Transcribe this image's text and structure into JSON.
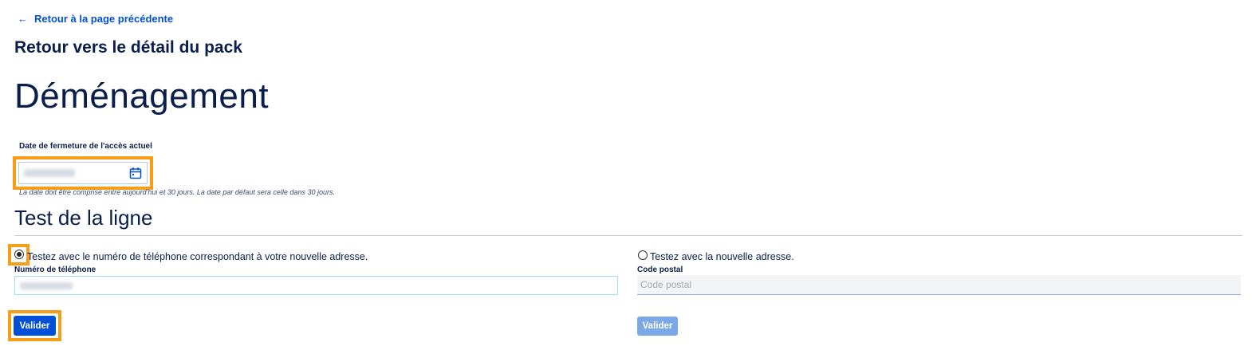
{
  "nav": {
    "back_arrow": "←",
    "back_label": "Retour à la page précédente"
  },
  "subtitle": "Retour vers le détail du pack",
  "page_title": "Déménagement",
  "closing_date": {
    "label": "Date de fermeture de l'accès actuel",
    "icon": "calendar-icon",
    "help": "La date doit être comprise entre aujourd'hui et 30 jours. La date par défaut sera celle dans 30 jours."
  },
  "line_test": {
    "title": "Test de la ligne",
    "option_phone": {
      "label": "Testez avec le numéro de téléphone correspondant à votre nouvelle adresse.",
      "selected": true,
      "field_label": "Numéro de téléphone",
      "button": "Valider"
    },
    "option_address": {
      "label": "Testez avec la nouvelle adresse.",
      "selected": false,
      "field_label": "Code postal",
      "placeholder": "Code postal",
      "button": "Valider"
    }
  },
  "colors": {
    "accent": "#0050d7",
    "highlight": "#f99c17",
    "text": "#0a1e4b",
    "disabled_button": "#7ba8e6"
  }
}
